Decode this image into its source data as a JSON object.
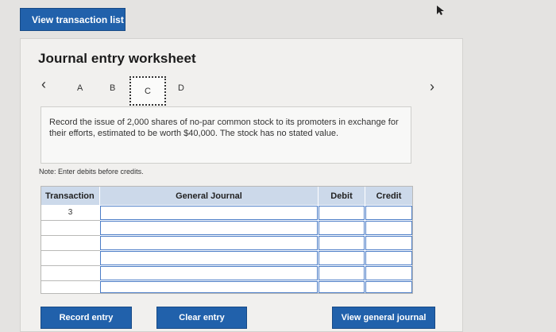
{
  "top": {
    "view_transaction_list": "View transaction list"
  },
  "worksheet": {
    "title": "Journal entry worksheet",
    "tabs": [
      "A",
      "B",
      "C",
      "D"
    ],
    "active_tab": "C",
    "prompt": "Record the issue of 2,000 shares of no-par common stock to its promoters in exchange for their efforts, estimated to be worth $40,000. The stock has no stated value.",
    "note": "Note: Enter debits before credits."
  },
  "table": {
    "headers": {
      "transaction": "Transaction",
      "general_journal": "General Journal",
      "debit": "Debit",
      "credit": "Credit"
    },
    "rows": [
      {
        "transaction": "3",
        "account": "",
        "debit": "",
        "credit": ""
      },
      {
        "transaction": "",
        "account": "",
        "debit": "",
        "credit": ""
      },
      {
        "transaction": "",
        "account": "",
        "debit": "",
        "credit": ""
      },
      {
        "transaction": "",
        "account": "",
        "debit": "",
        "credit": ""
      },
      {
        "transaction": "",
        "account": "",
        "debit": "",
        "credit": ""
      },
      {
        "transaction": "",
        "account": "",
        "debit": "",
        "credit": ""
      }
    ]
  },
  "buttons": {
    "record_entry": "Record entry",
    "clear_entry": "Clear entry",
    "view_general_journal": "View general journal"
  },
  "colors": {
    "button_blue": "#2161ab",
    "header_blue": "#ccd9ea",
    "input_border": "#4c7dc7"
  },
  "icons": {
    "prev": "chevron-left-icon",
    "next": "chevron-right-icon",
    "cursor": "mouse-pointer-icon"
  }
}
